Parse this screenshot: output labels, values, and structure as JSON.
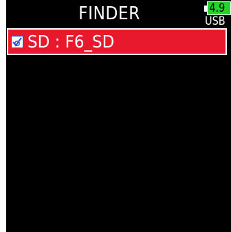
{
  "header": {
    "title": "FINDER",
    "battery": {
      "voltage": "4.9",
      "source": "USB",
      "color": "#25d32d"
    }
  },
  "list": {
    "items": [
      {
        "label": "SD : F6_SD",
        "checked": true,
        "selected": true,
        "highlight_color": "#e8192c",
        "icon": "checkbox-checked-icon"
      }
    ]
  }
}
